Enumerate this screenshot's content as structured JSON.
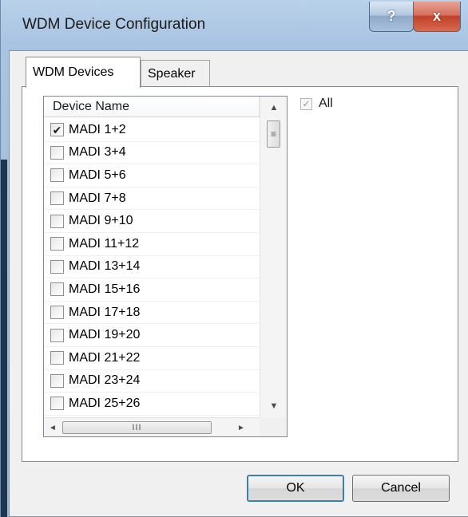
{
  "window": {
    "title": "WDM Device Configuration",
    "help_glyph": "?",
    "close_glyph": "x"
  },
  "tabs": [
    {
      "label": "WDM Devices",
      "active": true
    },
    {
      "label": "Speaker",
      "active": false
    }
  ],
  "device_list": {
    "header": "Device Name",
    "rows": [
      {
        "label": "MADI 1+2",
        "checked": true
      },
      {
        "label": "MADI 3+4",
        "checked": false
      },
      {
        "label": "MADI 5+6",
        "checked": false
      },
      {
        "label": "MADI 7+8",
        "checked": false
      },
      {
        "label": "MADI 9+10",
        "checked": false
      },
      {
        "label": "MADI 11+12",
        "checked": false
      },
      {
        "label": "MADI 13+14",
        "checked": false
      },
      {
        "label": "MADI 15+16",
        "checked": false
      },
      {
        "label": "MADI 17+18",
        "checked": false
      },
      {
        "label": "MADI 19+20",
        "checked": false
      },
      {
        "label": "MADI 21+22",
        "checked": false
      },
      {
        "label": "MADI 23+24",
        "checked": false
      },
      {
        "label": "MADI 25+26",
        "checked": false
      }
    ],
    "check_glyph": "✔",
    "scroll": {
      "up": "▲",
      "down": "▼",
      "left": "◄",
      "right": "►",
      "v_grip": "≡",
      "h_grip": "III"
    }
  },
  "all_checkbox": {
    "label": "All",
    "checked": true,
    "enabled": false,
    "check_glyph": "✓"
  },
  "buttons": {
    "ok": "OK",
    "cancel": "Cancel"
  }
}
